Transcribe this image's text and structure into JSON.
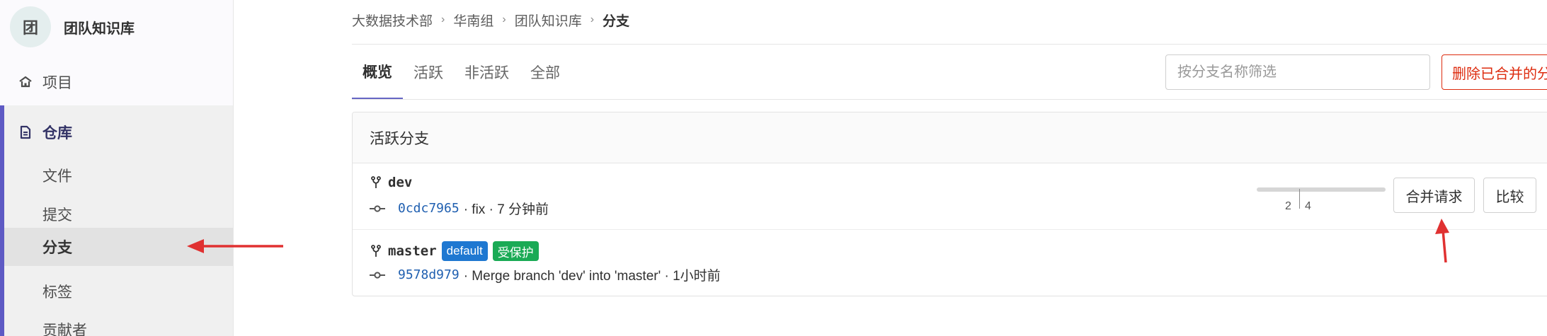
{
  "sidebar": {
    "avatar_letter": "团",
    "group_name": "团队知识库",
    "projects_label": "项目",
    "repo_label": "仓库",
    "repo_items": [
      {
        "label": "文件"
      },
      {
        "label": "提交"
      },
      {
        "label": "分支"
      },
      {
        "label": "标签"
      },
      {
        "label": "贡献者"
      }
    ]
  },
  "breadcrumb": [
    "大数据技术部",
    "华南组",
    "团队知识库",
    "分支"
  ],
  "tabs": [
    {
      "label": "概览"
    },
    {
      "label": "活跃"
    },
    {
      "label": "非活跃"
    },
    {
      "label": "全部"
    }
  ],
  "filter": {
    "placeholder": "按分支名称筛选",
    "value": ""
  },
  "delete_merged_label": "删除已合并的分支",
  "panel_title": "活跃分支",
  "branches": [
    {
      "name": "dev",
      "sha": "0cdc7965",
      "message": "· fix · 7 分钟前",
      "behind": "2",
      "ahead": "4",
      "merge_request_label": "合并请求",
      "compare_label": "比较"
    },
    {
      "name": "master",
      "badge_default": "default",
      "badge_protected": "受保护",
      "sha": "9578d979",
      "message": "· Merge branch 'dev' into 'master' · 1小时前"
    }
  ],
  "colors": {
    "accent": "#5e5ac4",
    "danger": "#dd2b0e",
    "badge_default": "#1f78d1",
    "badge_protected": "#1aaa55",
    "annotation_arrow": "#e03131"
  },
  "icons": {
    "projects": "home-icon",
    "repo": "document-icon",
    "branch": "branch-fork-icon",
    "commit": "commit-icon"
  }
}
